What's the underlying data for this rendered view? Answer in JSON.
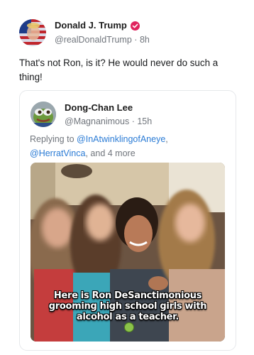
{
  "post": {
    "author_name": "Donald J. Trump",
    "author_handle": "@realDonaldTrump",
    "separator": "·",
    "time": "8h",
    "text": "That's not Ron, is it? He would never do such a thing!",
    "verified_icon": "verified-badge-icon"
  },
  "quote": {
    "author_name": "Dong-Chan Lee",
    "author_handle": "@Magnanimous",
    "separator": "·",
    "time": "15h",
    "replying_prefix": "Replying to",
    "reply_handle_1": "@InAtwinklingofAneye",
    "reply_sep": ",",
    "reply_handle_2": "@HerratVinca",
    "reply_suffix": ", and 4 more",
    "caption_line_1": "Here is Ron DeSanctimonious",
    "caption_line_2": "grooming high school girls with",
    "caption_line_3": "alcohol as a teacher.",
    "caption_emoji": "nauseated-face-icon"
  },
  "colors": {
    "verified": "#e0245e",
    "link": "#2a7bd5",
    "muted": "#70757c"
  }
}
